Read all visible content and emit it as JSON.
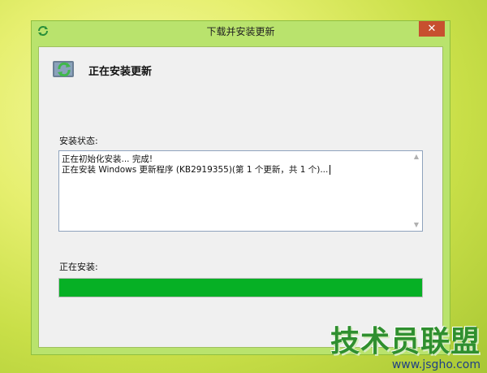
{
  "window": {
    "title": "下载并安装更新",
    "close_symbol": "✕"
  },
  "header": {
    "title": "正在安装更新",
    "icon": "windows-update-icon"
  },
  "status": {
    "label": "安装状态:",
    "lines": [
      "正在初始化安装... 完成!",
      "正在安装 Windows 更新程序 (KB2919355)(第 1 个更新，共 1 个)..."
    ]
  },
  "progress": {
    "label": "正在安装:",
    "value": 1.0,
    "color": "#06b025"
  },
  "watermark": {
    "brand": "技术员联盟",
    "site": "www.jsgho.com"
  },
  "colors": {
    "window_frame": "#b9e36d",
    "close_button": "#c7502f",
    "client_bg": "#f0f0f0"
  }
}
